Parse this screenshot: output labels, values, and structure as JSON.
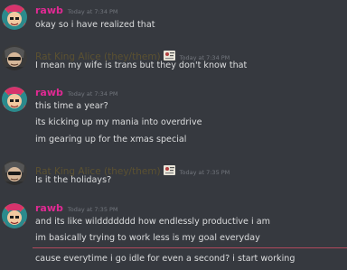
{
  "messages": [
    {
      "author": "rawb",
      "timestamp": "Today at 7:34 PM",
      "lines": [
        "okay so i have realized that"
      ]
    },
    {
      "author": "Rat King Alice (they/them)",
      "timestamp": "Today at 7:34 PM",
      "lines": [
        "I mean my wife is trans but they don't know that"
      ]
    },
    {
      "author": "rawb",
      "timestamp": "Today at 7:34 PM",
      "lines": [
        "this time a year?",
        "its kicking up my mania into overdrive",
        "im gearing up for the xmas special"
      ]
    },
    {
      "author": "Rat King Alice (they/them)",
      "timestamp": "Today at 7:35 PM",
      "lines": [
        "Is it the holidays?"
      ]
    },
    {
      "author": "rawb",
      "timestamp": "Today at 7:35 PM",
      "lines": [
        "and its like wilddddddd how endlessly productive i am",
        "im basically trying to work less is my goal everyday",
        "cause everytime i go idle for even a second? i start working"
      ]
    }
  ],
  "colors": {
    "background": "#36393f",
    "rawb_name": "#e02a93",
    "alice_name": "#5b5131",
    "timestamp": "#72767d",
    "message_text": "#dcddde",
    "new_messages_divider": "#b04a5c"
  },
  "icons": {
    "avatar_rawb": "avatar-rawb-icon",
    "avatar_alice": "avatar-alice-icon",
    "badge_alice": "role-badge-icon"
  }
}
